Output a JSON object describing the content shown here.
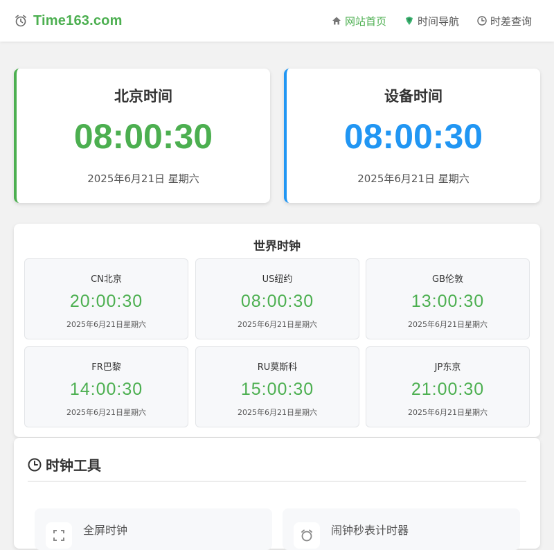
{
  "header": {
    "site_name": "Time163.com",
    "nav": [
      {
        "label": "网站首页",
        "icon": "home-icon",
        "active": true
      },
      {
        "label": "时间导航",
        "icon": "navigation-icon",
        "active": false
      },
      {
        "label": "时差查询",
        "icon": "clock-icon",
        "active": false
      }
    ]
  },
  "beijing": {
    "title": "北京时间",
    "time": "08:00:30",
    "date": "2025年6月21日 星期六"
  },
  "device": {
    "title": "设备时间",
    "time": "08:00:30",
    "date": "2025年6月21日 星期六"
  },
  "world_clock": {
    "title": "世界时钟",
    "cities": [
      {
        "name": "CN北京",
        "time": "20:00:30",
        "date": "2025年6月21日星期六"
      },
      {
        "name": "US纽约",
        "time": "08:00:30",
        "date": "2025年6月21日星期六"
      },
      {
        "name": "GB伦敦",
        "time": "13:00:30",
        "date": "2025年6月21日星期六"
      },
      {
        "name": "FR巴黎",
        "time": "14:00:30",
        "date": "2025年6月21日星期六"
      },
      {
        "name": "RU莫斯科",
        "time": "15:00:30",
        "date": "2025年6月21日星期六"
      },
      {
        "name": "JP东京",
        "time": "21:00:30",
        "date": "2025年6月21日星期六"
      }
    ]
  },
  "tools": {
    "title": "时钟工具",
    "items": [
      {
        "label": "全屏时钟",
        "icon": "fullscreen-icon"
      },
      {
        "label": "闹钟秒表计时器",
        "icon": "alarm-icon"
      }
    ]
  },
  "colors": {
    "accent_green": "#4caf50",
    "accent_blue": "#2196f3"
  }
}
